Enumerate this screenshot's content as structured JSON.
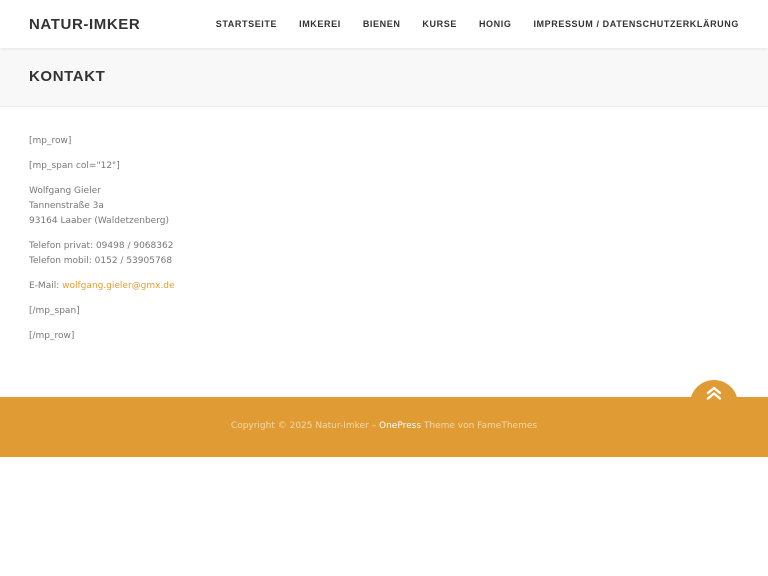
{
  "header": {
    "logo": "NATUR-IMKER",
    "nav": [
      {
        "label": "STARTSEITE"
      },
      {
        "label": "IMKEREI"
      },
      {
        "label": "BIENEN"
      },
      {
        "label": "KURSE"
      },
      {
        "label": "HONIG"
      },
      {
        "label": "IMPRESSUM / DATENSCHUTZERKLÄRUNG"
      }
    ]
  },
  "page": {
    "title": "KONTAKT"
  },
  "content": {
    "shortcode_row_open": "[mp_row]",
    "shortcode_span_open": "[mp_span col=\"12\"]",
    "address": {
      "name": "Wolfgang Gieler",
      "street": "Tannenstraße 3a",
      "city": "93164 Laaber (Waldetzenberg)"
    },
    "phone": {
      "private": "Telefon privat: 09498 / 9068362",
      "mobile": "Telefon mobil: 0152 / 53905768"
    },
    "email": {
      "label": "E-Mail: ",
      "address": "wolfgang.gieler@gmx.de"
    },
    "shortcode_span_close": "[/mp_span]",
    "shortcode_row_close": "[/mp_row]"
  },
  "footer": {
    "copyright": "Copyright © 2025 Natur-Imker – ",
    "theme_link": "OnePress",
    "theme_suffix": " Theme von FameThemes"
  },
  "back_to_top_icon": "double-chevron-up-icon",
  "colors": {
    "accent": "#e19b34",
    "link": "#e29d2e",
    "heading": "#333333",
    "text": "#777777",
    "titlebar_bg": "#f8f8f8"
  }
}
